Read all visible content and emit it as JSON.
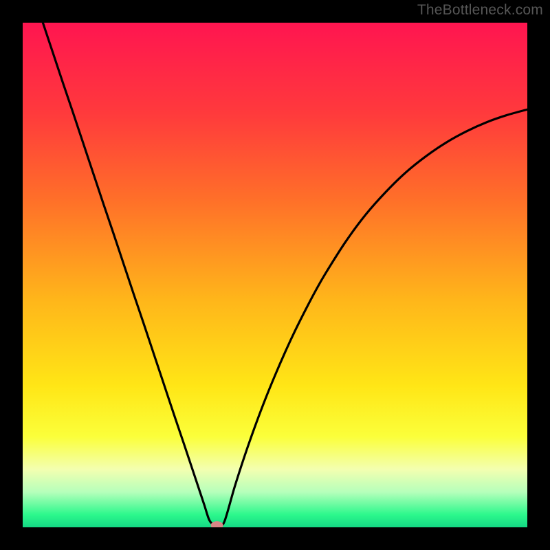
{
  "attribution": "TheBottleneck.com",
  "gradient_stops": [
    {
      "offset": 0.0,
      "color": "#ff1550"
    },
    {
      "offset": 0.18,
      "color": "#ff3a3c"
    },
    {
      "offset": 0.35,
      "color": "#ff6f29"
    },
    {
      "offset": 0.55,
      "color": "#ffb61a"
    },
    {
      "offset": 0.72,
      "color": "#ffe616"
    },
    {
      "offset": 0.82,
      "color": "#fbff3a"
    },
    {
      "offset": 0.885,
      "color": "#f3ffb0"
    },
    {
      "offset": 0.93,
      "color": "#b6ffbb"
    },
    {
      "offset": 0.975,
      "color": "#2cf88c"
    },
    {
      "offset": 1.0,
      "color": "#14d884"
    }
  ],
  "chart_data": {
    "type": "line",
    "title": "",
    "xlabel": "",
    "ylabel": "",
    "xlim": [
      0,
      100
    ],
    "ylim": [
      0,
      100
    ],
    "series": [
      {
        "name": "bottleneck-curve",
        "x": [
          4,
          6,
          8,
          10,
          12,
          14,
          16,
          18,
          20,
          22,
          24,
          26,
          28,
          30,
          32,
          33,
          34,
          35,
          36,
          37,
          38,
          39,
          40,
          42,
          44,
          46,
          48,
          50,
          52,
          54,
          56,
          58,
          60,
          64,
          68,
          72,
          76,
          80,
          84,
          88,
          92,
          96,
          100
        ],
        "y": [
          100,
          94.0,
          88.0,
          82.1,
          76.1,
          70.1,
          64.1,
          58.2,
          52.2,
          46.2,
          40.3,
          34.3,
          28.3,
          22.3,
          16.4,
          13.4,
          10.4,
          7.4,
          4.4,
          1.4,
          0.5,
          0.5,
          1.2,
          8.0,
          14.2,
          19.9,
          25.2,
          30.1,
          34.7,
          39.0,
          43.0,
          46.8,
          50.3,
          56.6,
          62.0,
          66.5,
          70.4,
          73.6,
          76.3,
          78.5,
          80.3,
          81.7,
          82.8
        ]
      },
      {
        "name": "bottleneck-max-marker",
        "marker_x": 38.5,
        "marker_y": 0.4
      }
    ]
  }
}
